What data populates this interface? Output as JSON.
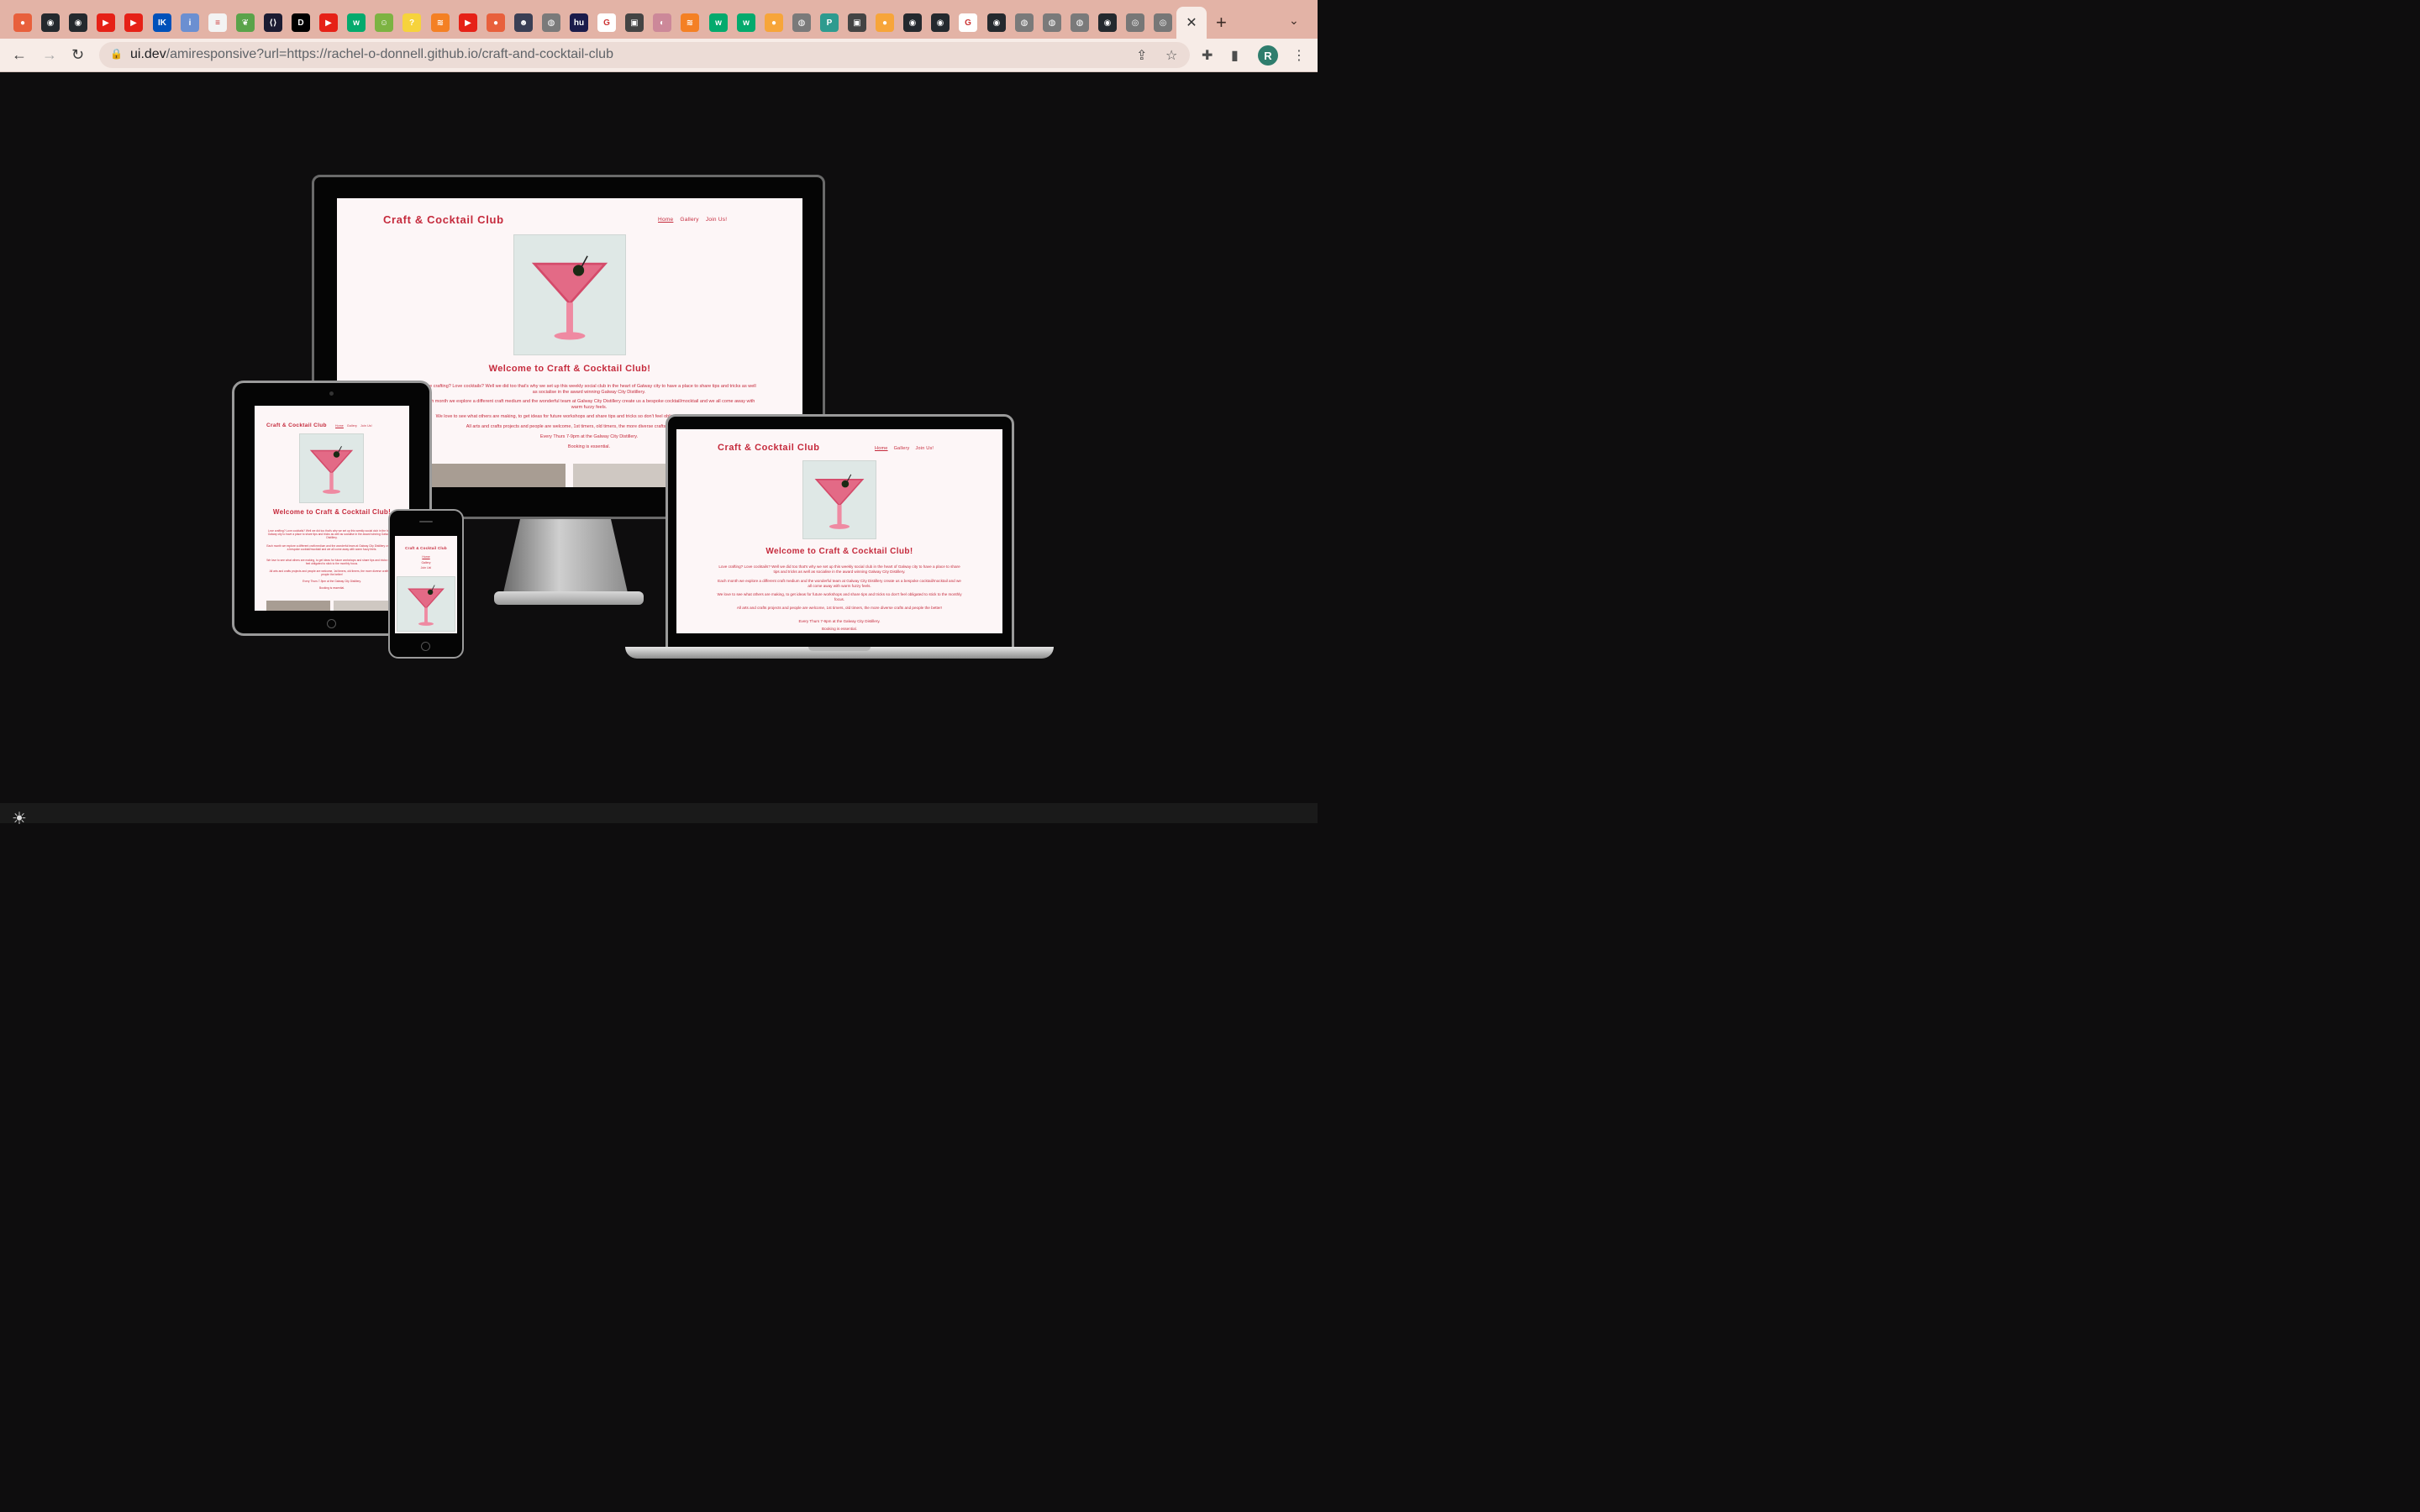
{
  "browser": {
    "tab_icons": [
      "circle-orange-icon",
      "github-icon",
      "github-icon",
      "youtube-icon",
      "youtube-icon",
      "ikea-icon",
      "info-icon",
      "doc-icon",
      "leaf-icon",
      "code-icon",
      "dev-icon",
      "youtube-icon",
      "w3-icon",
      "android-icon",
      "question-icon",
      "stack-icon",
      "youtube-icon",
      "circle-orange-icon",
      "avatar-icon",
      "globe-icon",
      "hu-icon",
      "google-icon",
      "picture-icon",
      "photo-icon",
      "stack-icon",
      "w3-icon",
      "w3-icon",
      "orange-icon",
      "globe-icon",
      "p-icon",
      "picture-icon",
      "orange-icon",
      "github-icon",
      "github-icon",
      "google-icon",
      "github-icon",
      "globe-icon",
      "globe-icon",
      "globe-icon",
      "github-icon",
      "chrome-icon",
      "chrome-icon"
    ],
    "address": {
      "domain": "ui.dev",
      "path": "/amiresponsive?url=https://rachel-o-donnell.github.io/craft-and-cocktail-club"
    },
    "profile_initial": "R"
  },
  "site": {
    "title": "Craft & Cocktail Club",
    "nav": {
      "home": "Home",
      "gallery": "Gallery",
      "join": "Join Us!"
    },
    "welcome": "Welcome to Craft & Cocktail Club!",
    "paragraphs": [
      "Love crafting? Love cocktails? Well we did too that's why we set up this weekly social club in the heart of Galway city to have a place to share tips and tricks as well as socialise in the award winning Galway City Distillery.",
      "Each month we explore a different craft medium and the wonderful team at Galway City Distillery create us a bespoke cocktail/mocktail and we all come away with warm fuzzy feels.",
      "We love to see what others are making, to get ideas for future workshops and share tips and tricks so don't feel obligated to stick to the monthly focus.",
      "All arts and crafts projects and people are welcome, 1st timers, old timers, the more diverse crafts and people the better!",
      "Every Thurs 7-9pm at the Galway City Distillery.",
      "Booking is essential."
    ]
  },
  "colors": {
    "brand": "#c52a3c",
    "tabbar": "#e3b3a6",
    "stage": "#0e0d0e"
  }
}
